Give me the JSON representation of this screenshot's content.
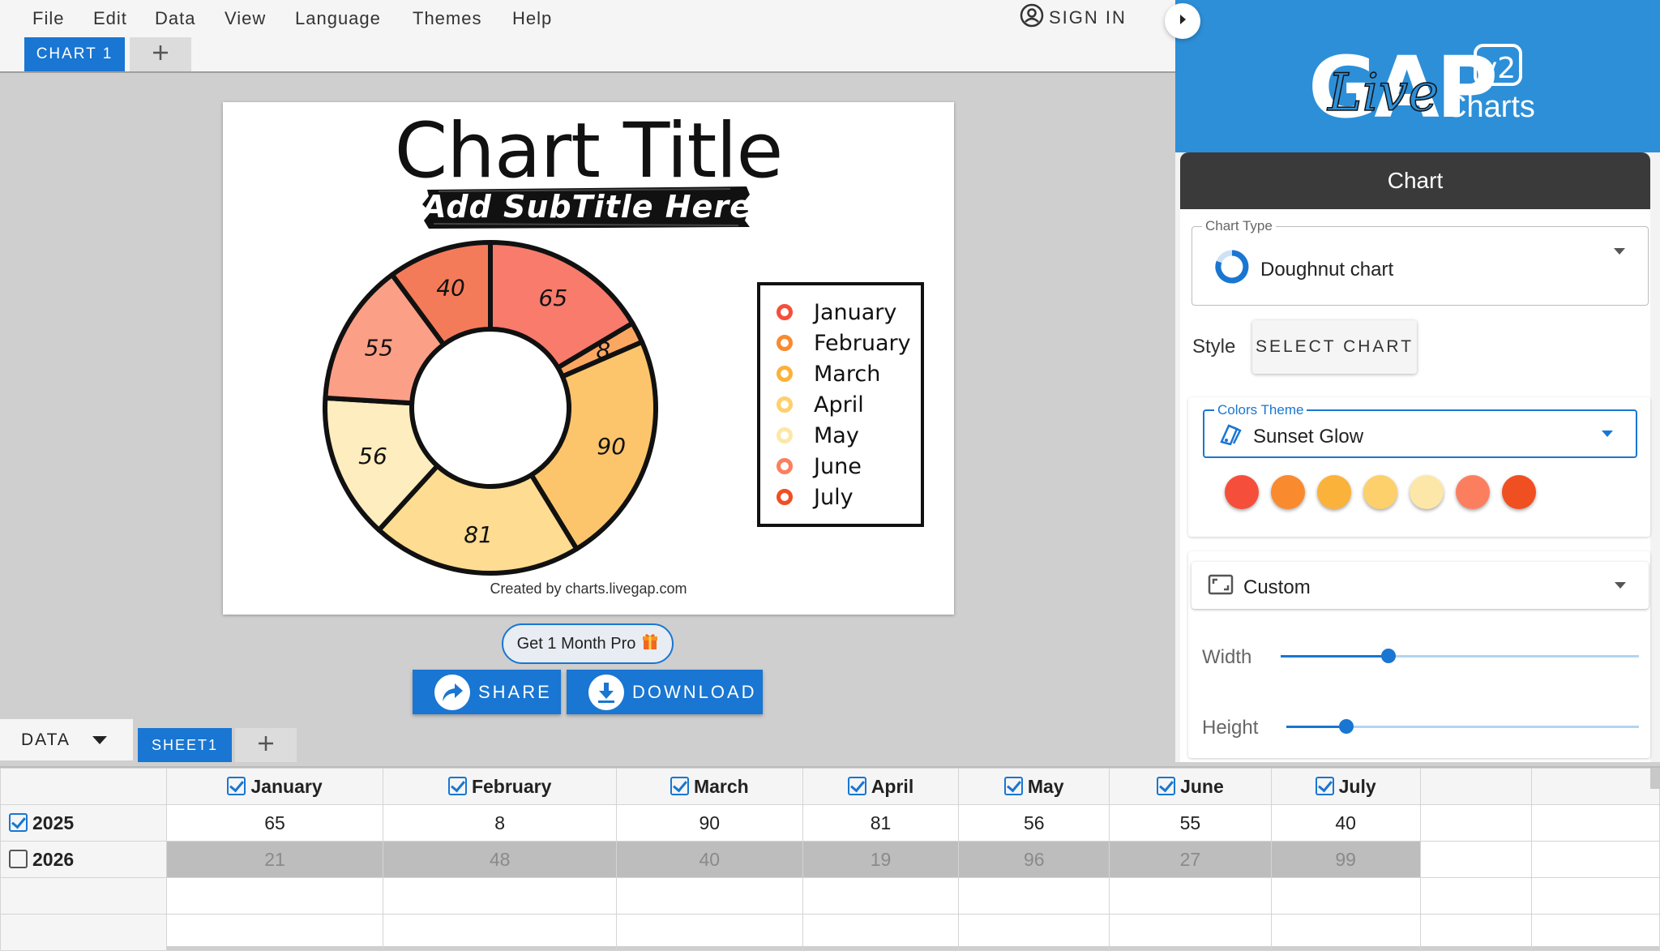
{
  "menu": {
    "items": [
      "File",
      "Edit",
      "Data",
      "View",
      "Language",
      "Themes",
      "Help"
    ],
    "sign_in": "SIGN IN"
  },
  "chart_tabs": {
    "active": "CHART 1",
    "add": "+"
  },
  "chart_data": {
    "type": "doughnut",
    "title": "Chart Title",
    "subtitle": "Add SubTitle Here",
    "categories": [
      "January",
      "February",
      "March",
      "April",
      "May",
      "June",
      "July"
    ],
    "series": [
      {
        "name": "2025",
        "values": [
          65,
          8,
          90,
          81,
          56,
          55,
          40
        ]
      }
    ],
    "colors": [
      "#f54f3b",
      "#f98a2e",
      "#fbb23a",
      "#fdd06c",
      "#fde7a8",
      "#fb7f5f",
      "#f04f22"
    ],
    "legend_position": "right",
    "credit": "Created by charts.livegap.com"
  },
  "actions": {
    "promo": "Get 1 Month Pro",
    "share": "SHARE",
    "download": "DOWNLOAD"
  },
  "data_tabs": {
    "menu": "DATA",
    "sheet": "SHEET1",
    "add": "+"
  },
  "grid": {
    "columns": [
      "January",
      "February",
      "March",
      "April",
      "May",
      "June",
      "July"
    ],
    "rows": [
      {
        "label": "2025",
        "checked": true,
        "values": [
          "65",
          "8",
          "90",
          "81",
          "56",
          "55",
          "40"
        ]
      },
      {
        "label": "2026",
        "checked": false,
        "values": [
          "21",
          "48",
          "40",
          "19",
          "96",
          "27",
          "99"
        ]
      }
    ]
  },
  "panel": {
    "logo_text": "Charts",
    "logo_version": "v2",
    "section_title": "Chart",
    "chart_type": {
      "label": "Chart Type",
      "value": "Doughnut chart"
    },
    "style": {
      "label": "Style",
      "button": "SELECT CHART"
    },
    "colors_theme": {
      "label": "Colors Theme",
      "value": "Sunset Glow",
      "swatches": [
        "#f54f3b",
        "#f98a2e",
        "#fbb23a",
        "#fdd06c",
        "#fde7a8",
        "#fb7f5f",
        "#f04f22"
      ]
    },
    "size": {
      "mode": "Custom",
      "width_label": "Width",
      "height_label": "Height",
      "width_value": 0.3,
      "height_value": 0.17
    }
  }
}
